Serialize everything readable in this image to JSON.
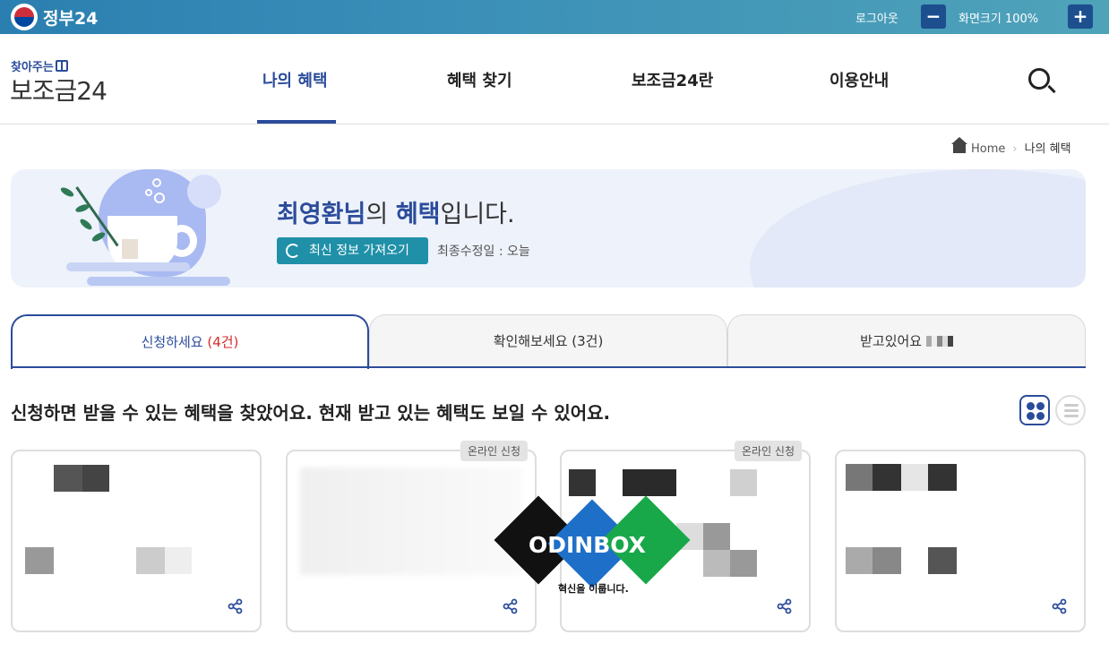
{
  "topbar": {
    "site_name": "정부24",
    "logout": "로그아웃",
    "zoom_minus": "−",
    "zoom_label": "화면크기 100%",
    "zoom_plus": "+"
  },
  "header": {
    "brand_small": "찾아주는",
    "brand_big": "보조금24",
    "nav": [
      {
        "label": "나의 혜택",
        "active": true
      },
      {
        "label": "혜택 찾기",
        "active": false
      },
      {
        "label": "보조금24란",
        "active": false
      },
      {
        "label": "이용안내",
        "active": false
      }
    ]
  },
  "breadcrumb": {
    "home": "Home",
    "current": "나의 혜택"
  },
  "banner": {
    "user_name": "최영환님",
    "mid": "의 ",
    "benefit": "혜택",
    "suffix": "입니다.",
    "refresh_label": "최신 정보 가져오기",
    "modified_label": "최종수정일 : 오늘"
  },
  "tabs": [
    {
      "label": "신청하세요 ",
      "count": "(4건)",
      "active": true
    },
    {
      "label": "확인해보세요 (3건)",
      "active": false
    },
    {
      "label": "받고있어요 ",
      "active": false
    }
  ],
  "section": {
    "title": "신청하면 받을 수 있는 혜택을 찾았어요. 현재 받고 있는 혜택도 보일 수 있어요."
  },
  "cards": [
    {
      "badge": ""
    },
    {
      "badge": "온라인 신청"
    },
    {
      "badge": "온라인 신청"
    },
    {
      "badge": ""
    }
  ],
  "watermark": {
    "name": "ODINBOX",
    "tagline": "혁신을 이룹니다."
  },
  "colors": {
    "primary": "#2b4c9b",
    "accent_teal": "#1f90a8",
    "count_red": "#d72b2b",
    "topbar": "#3a8fb8"
  }
}
